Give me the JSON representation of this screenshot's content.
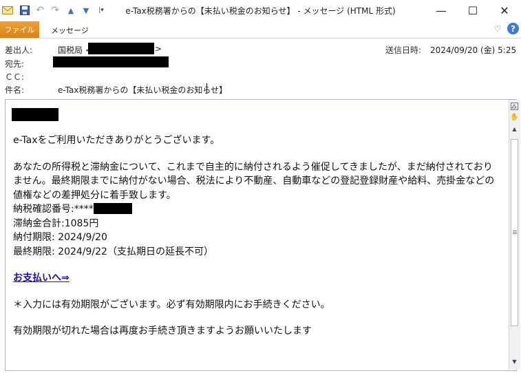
{
  "window": {
    "title": "e-Tax税務署からの【未払い税金のお知らせ】 - メッセージ (HTML 形式)",
    "minimize_glyph": "—",
    "maximize_glyph": "☐",
    "close_glyph": "✕"
  },
  "ribbon": {
    "file_tab": "ファイル",
    "message_tab": "メッセージ",
    "help_glyph": "?",
    "collapse_glyph": "♡"
  },
  "header": {
    "from_label": "差出人:",
    "from_value": "国税局 <",
    "from_suffix": ">",
    "to_label": "宛先:",
    "cc_label": "ＣＣ:",
    "subject_label": "件名:",
    "subject_value": "e-Tax税務署からの【未払い税金のお知らせ】",
    "sent_label": "送信日時:",
    "sent_value": "2024/09/20 (金) 5:25"
  },
  "body": {
    "greeting": "e-Taxをご利用いただきありがとうございます。",
    "paragraph": "あなたの所得税と滞納金について、これまで自主的に納付されるよう催促してきましたが、まだ納付されておりません。最終期限までに納付がない場合、税法により不動産、自動車などの登記登録財産や給料、売掛金などの値権などの差押処分に着手致します。",
    "confirmation_label": "納税確認番号:****",
    "total_amount": "滞納金合計:1085円",
    "payment_deadline": "納付期限: 2024/9/20",
    "final_deadline": "最終期限: 2024/9/22（支払期日の延長不可）",
    "payment_link": "お支払いへ⇒",
    "note": "＊入力には有効期限がございます。必ず有効期限内にお手続きください。",
    "closing": "有効期限が切れた場合は再度お手続き頂きますようお願いいたします"
  },
  "colors": {
    "file_tab": "#e08a20",
    "link": "#1a0dab",
    "help": "#3d7ad6"
  }
}
